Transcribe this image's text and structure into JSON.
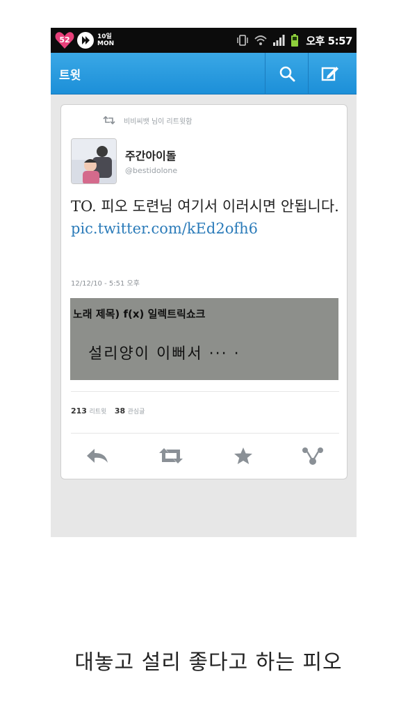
{
  "status_bar": {
    "notification_count": "52",
    "date_day": "10일",
    "date_weekday": "MON",
    "time": "오후 5:57"
  },
  "action_bar": {
    "title": "트윗",
    "icons": [
      "search-icon",
      "compose-icon"
    ]
  },
  "tweet": {
    "retweeted_by": "비비씨뱃 님이 리트윗함",
    "author_name": "주간아이돌",
    "author_handle": "@bestidolone",
    "text": "TO. 피오 도련님 여기서 이러시면 안됩니다. ",
    "link": "pic.twitter.com/kEd2ofh6",
    "timestamp": "12/12/10 - 5:51 오후",
    "photo_line1": "노래 제목) f(x) 일렉트릭쇼크",
    "photo_line2": "설리양이 이뻐서 ··· ·",
    "retweet_count": "213",
    "retweet_label": "리트윗",
    "favorite_count": "38",
    "favorite_label": "관심글",
    "action_icons": [
      "reply-icon",
      "retweet-icon",
      "favorite-icon",
      "more-icon"
    ]
  },
  "caption": "대놓고 설리 좋다고 하는 피오",
  "colors": {
    "action_bar": "#2a9be0",
    "link": "#2b7bb9",
    "status_bar": "#0c0c0c",
    "background": "#e7e7e7"
  }
}
